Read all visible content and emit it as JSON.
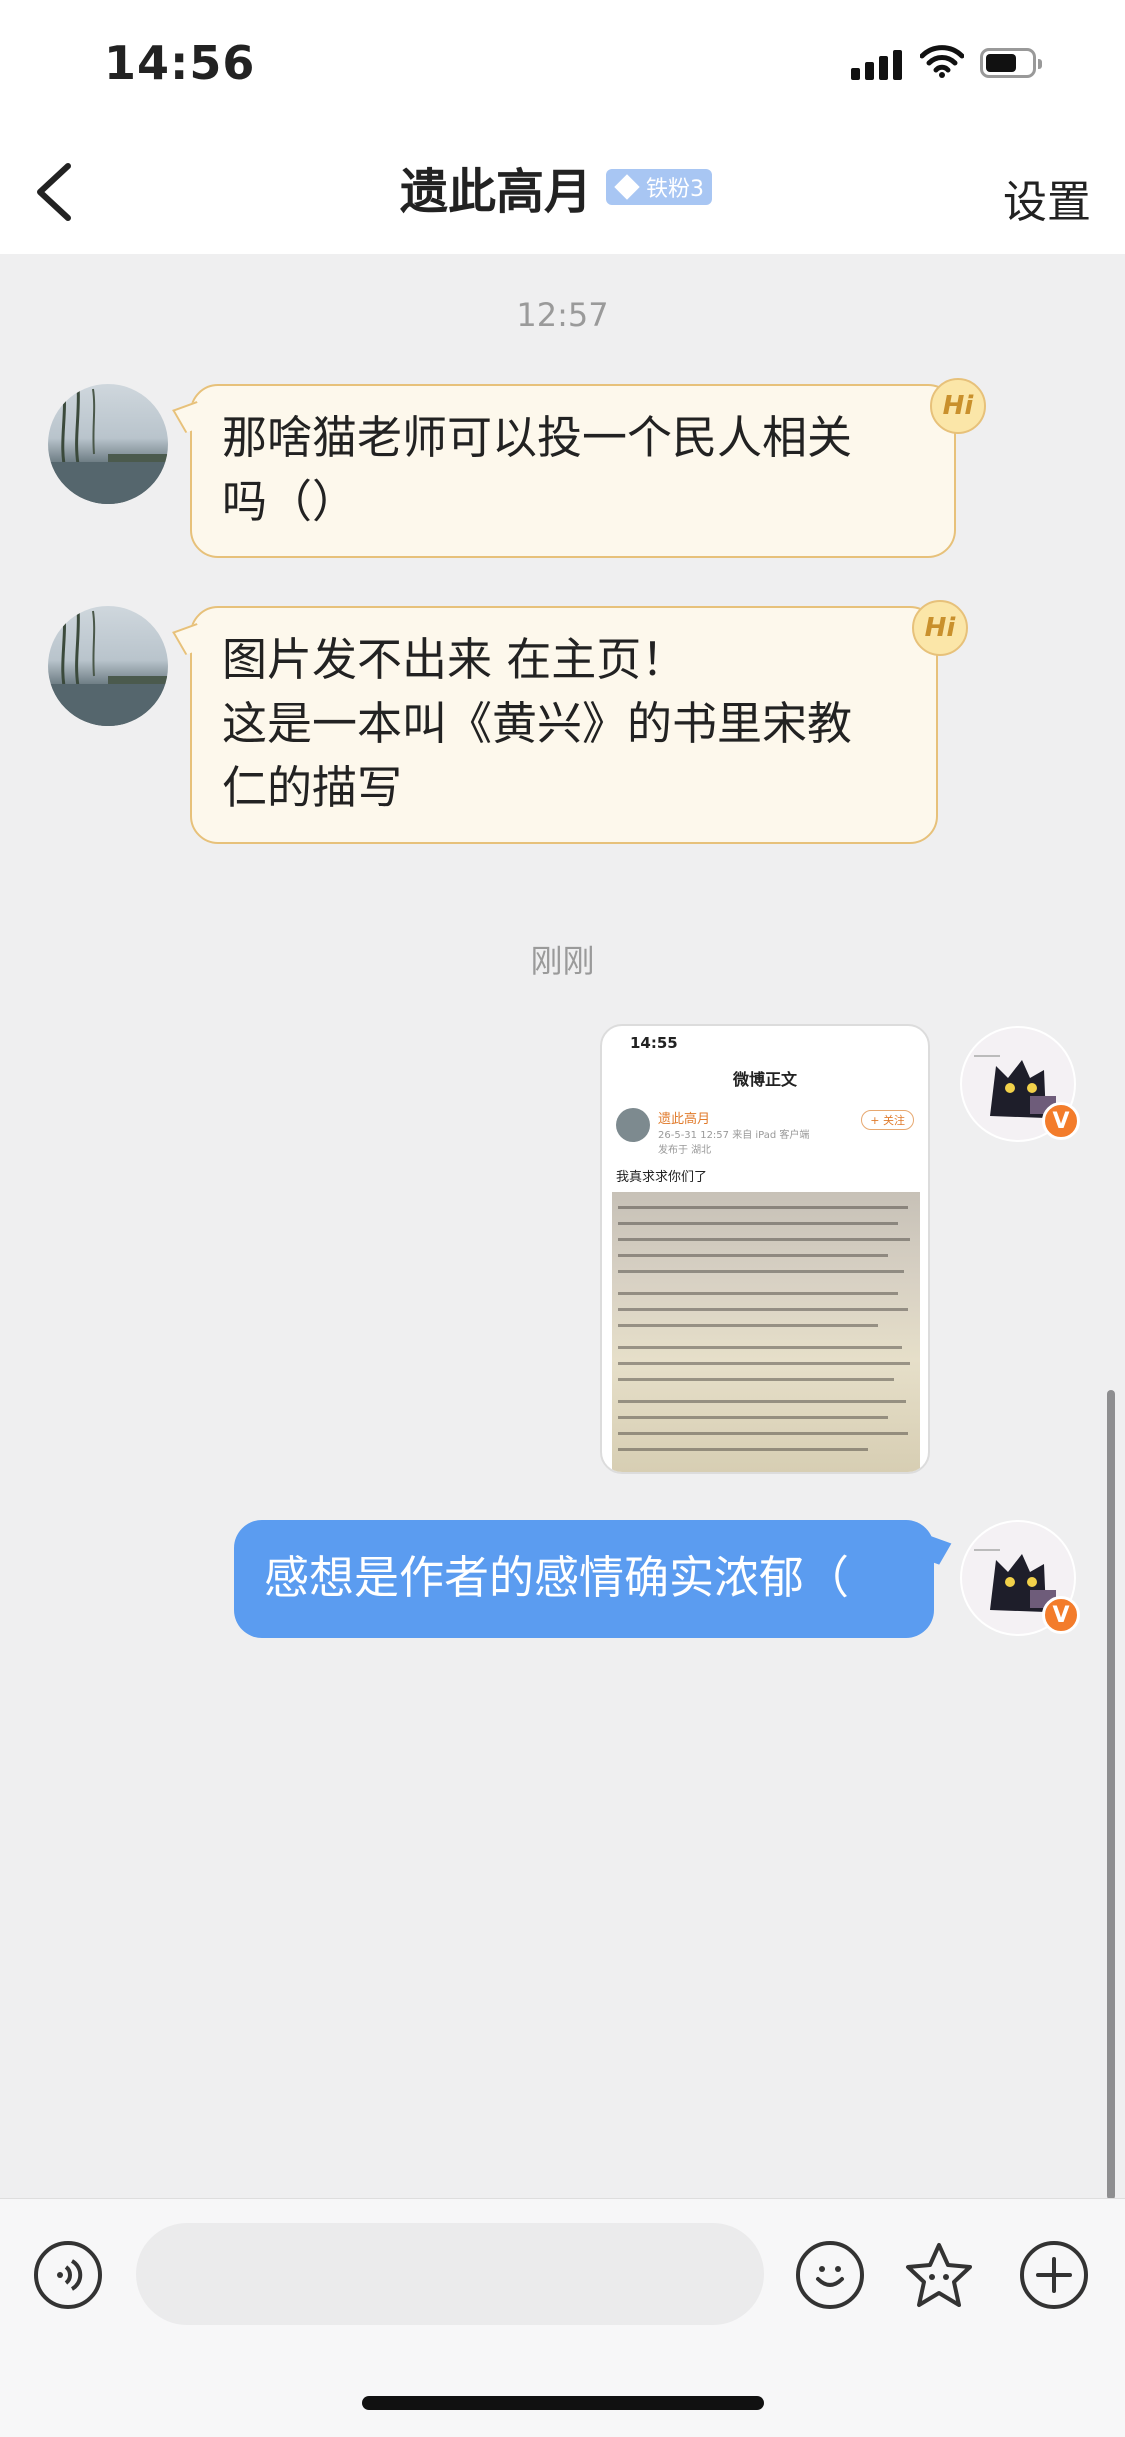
{
  "status_bar": {
    "time": "14:56"
  },
  "header": {
    "title": "遗此高月",
    "badge": "铁粉3",
    "settings_label": "设置"
  },
  "messages": {
    "timestamp1": "12:57",
    "in1_lines": [
      "那啥猫老师可以投一个民人相关",
      "吗（）"
    ],
    "in2_lines": [
      "图片发不出来 在主页！",
      "这是一本叫《黄兴》的书里宋教",
      "仁的描写"
    ],
    "hi_label": "Hi",
    "timestamp2": "刚刚",
    "image_preview": {
      "time": "14:55",
      "title": "微博正文",
      "user": "遗此高月",
      "meta_line1": "26-5-31 12:57 来自 iPad 客户端",
      "meta_line2": "发布于 湖北",
      "follow": "+ 关注",
      "post_text": "我真求求你们了"
    },
    "out1": "感想是作者的感情确实浓郁（",
    "verified_mark": "V"
  }
}
